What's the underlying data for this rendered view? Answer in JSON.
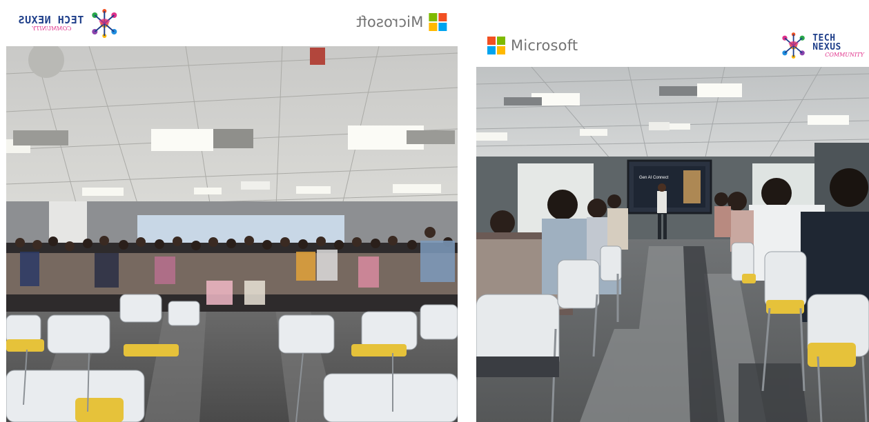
{
  "left_panel": {
    "tech_nexus_logo": {
      "title": "TECH NEXUS",
      "subtitle": "COMMUNITY"
    },
    "microsoft_logo": {
      "wordmark": "Microsoft"
    }
  },
  "right_panel": {
    "microsoft_logo": {
      "wordmark": "Microsoft"
    },
    "tech_nexus_logo": {
      "title": "TECH NEXUS",
      "subtitle": "COMMUNITY"
    },
    "projector_slide": {
      "title": "Gen AI Connect"
    }
  },
  "colors": {
    "ms_red": "#f25022",
    "ms_green": "#7fba00",
    "ms_blue": "#00a4ef",
    "ms_yellow": "#ffb900",
    "tech_nexus_navy": "#1f3f8a",
    "tech_nexus_pink": "#e0318a"
  }
}
